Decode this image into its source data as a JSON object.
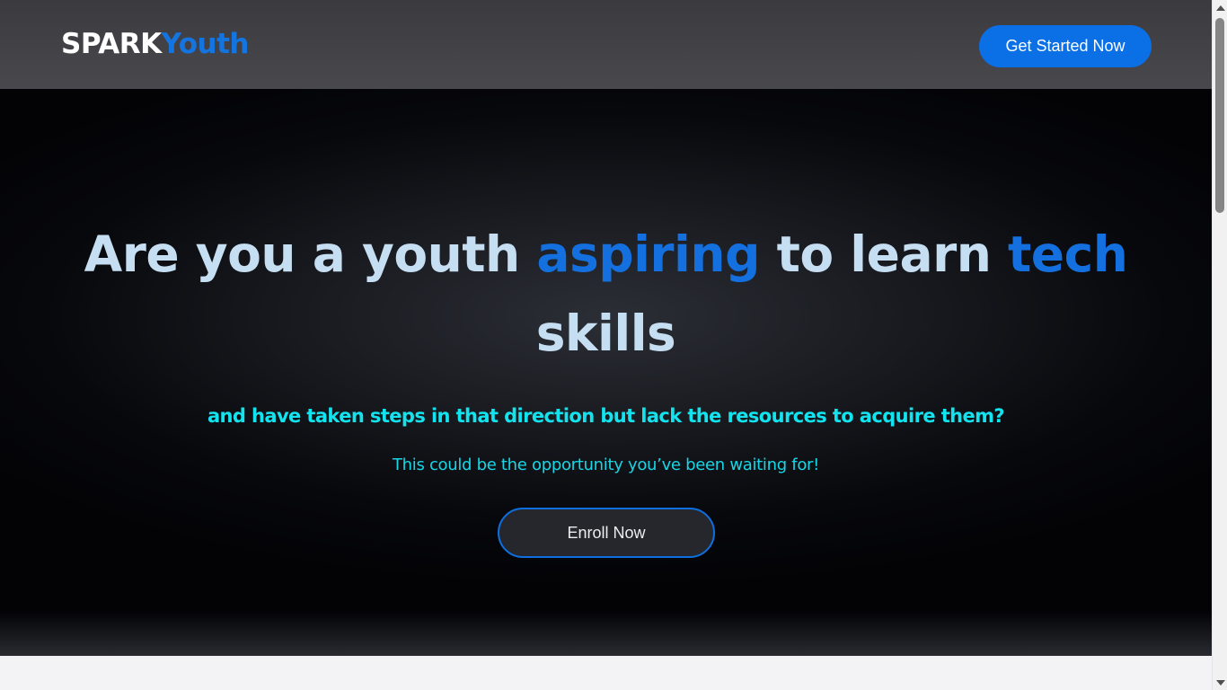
{
  "navbar": {
    "logo_part1": "SPARK",
    "logo_part2": "Youth",
    "cta_label": "Get Started Now"
  },
  "hero": {
    "title_1": "Are you a youth ",
    "title_hl1": "aspiring",
    "title_2": " to learn ",
    "title_hl2": "tech",
    "title_3": " skills",
    "subtitle": "and have taken steps in that direction but lack the resources to acquire them?",
    "note": "This could be the opportunity you’ve been waiting for!",
    "enroll_label": "Enroll Now"
  },
  "colors": {
    "accent_blue": "#0b6fe6",
    "highlight_blue": "#1470de",
    "title_text": "#c6def2",
    "cyan_text": "#13e3ee",
    "hero_bg": "#07080c"
  },
  "icons": {
    "scroll_up": "scroll-up-arrow-icon",
    "scroll_down": "scroll-down-arrow-icon"
  }
}
